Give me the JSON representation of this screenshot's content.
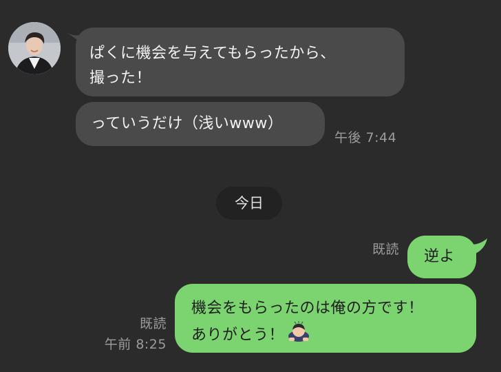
{
  "messages": [
    {
      "side": "received",
      "lines": [
        "ぱくに機会を与えてもらったから、",
        "撮った！"
      ]
    },
    {
      "side": "received",
      "lines": [
        "っていうだけ（浅いwww）"
      ],
      "time": "午後 7:44"
    },
    {
      "side": "sent",
      "lines": [
        "逆よ"
      ],
      "read": "既読"
    },
    {
      "side": "sent",
      "lines": [
        "機会をもらったのは俺の方です！",
        "ありがとう！"
      ],
      "read": "既読",
      "time": "午前 8:25",
      "emoji": "bowing-person-emoji"
    }
  ],
  "date_divider": "今日",
  "colors": {
    "background": "#2b2b2c",
    "received_bubble": "#4a4a4a",
    "sent_bubble": "#7bd46f",
    "meta_text": "#9c9c9c"
  },
  "icons": {
    "contact_avatar": "avatar"
  }
}
